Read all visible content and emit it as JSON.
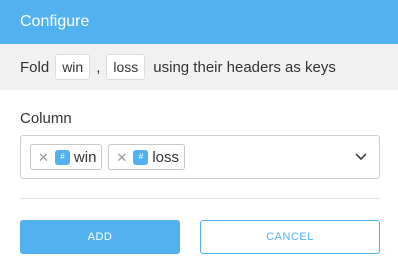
{
  "header": {
    "title": "Configure"
  },
  "summary": {
    "prefix": "Fold",
    "columns": [
      "win",
      "loss"
    ],
    "separator": ",",
    "suffix": "using their headers as keys"
  },
  "column_field": {
    "label": "Column",
    "selected": [
      {
        "label": "win",
        "type_icon": "number-type-icon"
      },
      {
        "label": "loss",
        "type_icon": "number-type-icon"
      }
    ]
  },
  "buttons": {
    "add": "ADD",
    "cancel": "CANCEL"
  },
  "colors": {
    "accent": "#52b2ef",
    "summary_bg": "#f1f1f1"
  }
}
